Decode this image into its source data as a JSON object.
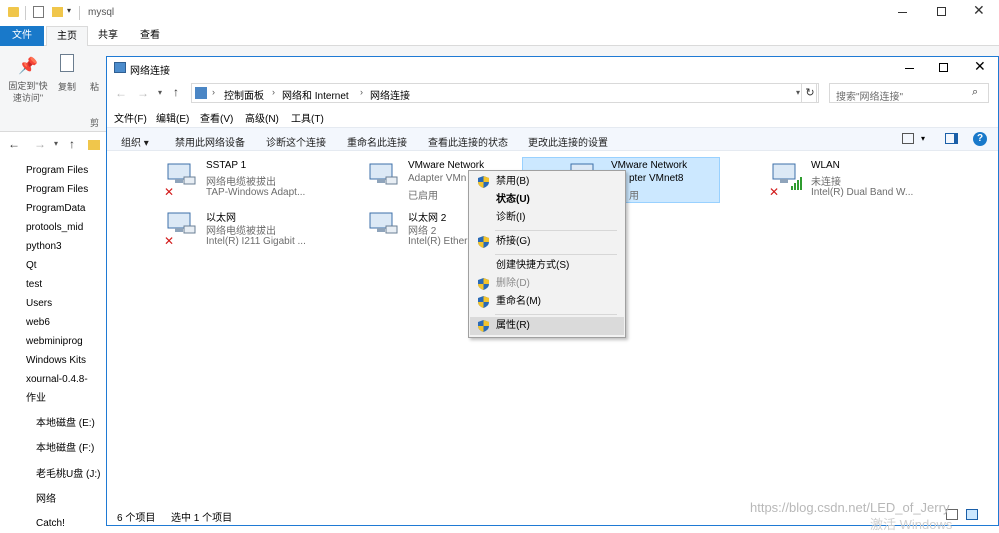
{
  "bg": {
    "title": "mysql",
    "tabs": [
      "文件",
      "主页",
      "共享",
      "查看"
    ],
    "ribbon": {
      "pin": "固定到\"快速访问\"",
      "copy": "复制",
      "paste_partial": "粘",
      "cut_partial": "剪"
    },
    "tree": [
      "Program Files",
      "Program Files",
      "ProgramData",
      "protools_mid",
      "python3",
      "Qt",
      "test",
      "Users",
      "web6",
      "webminiprog",
      "Windows Kits",
      "xournal-0.4.8-",
      "作业"
    ],
    "drives": [
      "本地磁盘 (E:)",
      "本地磁盘 (F:)",
      "老毛桃U盘 (J:)",
      "网络",
      "Catch!"
    ]
  },
  "win": {
    "title": "网络连接",
    "breadcrumb": [
      "控制面板",
      "网络和 Internet",
      "网络连接"
    ],
    "search_placeholder": "搜索\"网络连接\"",
    "menu": [
      "文件(F)",
      "编辑(E)",
      "查看(V)",
      "高级(N)",
      "工具(T)"
    ],
    "commands": [
      "组织 ▾",
      "禁用此网络设备",
      "诊断这个连接",
      "重命名此连接",
      "查看此连接的状态",
      "更改此连接的设置"
    ],
    "items": [
      {
        "name": "SSTAP 1",
        "status": "网络电缆被拔出",
        "device": "TAP-Windows Adapt...",
        "x_mark": true
      },
      {
        "name": "VMware Network",
        "status": "Adapter VMn",
        "device": "已启用",
        "x_mark": false
      },
      {
        "name": "VMware Network",
        "status": "pter VMnet8",
        "device": "用",
        "x_mark": false
      },
      {
        "name": "WLAN",
        "status": "未连接",
        "device": "Intel(R) Dual Band W...",
        "x_mark": true
      },
      {
        "name": "以太网",
        "status": "网络电缆被拔出",
        "device": "Intel(R) I211 Gigabit ...",
        "x_mark": true
      },
      {
        "name": "以太网 2",
        "status": "网络 2",
        "device": "Intel(R) Ether",
        "x_mark": false
      }
    ],
    "status_left": "6 个项目",
    "status_sel": "选中 1 个项目"
  },
  "context_menu": [
    {
      "label": "禁用(B)",
      "shield": true,
      "bold": false,
      "disabled": false
    },
    {
      "label": "状态(U)",
      "shield": false,
      "bold": true,
      "disabled": false
    },
    {
      "label": "诊断(I)",
      "shield": false,
      "bold": false,
      "disabled": false
    },
    {
      "label": "桥接(G)",
      "shield": true,
      "bold": false,
      "disabled": false
    },
    {
      "label": "创建快捷方式(S)",
      "shield": false,
      "bold": false,
      "disabled": false
    },
    {
      "label": "删除(D)",
      "shield": true,
      "bold": false,
      "disabled": true
    },
    {
      "label": "重命名(M)",
      "shield": true,
      "bold": false,
      "disabled": false
    },
    {
      "label": "属性(R)",
      "shield": true,
      "bold": false,
      "disabled": false
    }
  ],
  "watermark": "https://blog.csdn.net/LED_of_Jerry",
  "activate": "激活 Windows"
}
